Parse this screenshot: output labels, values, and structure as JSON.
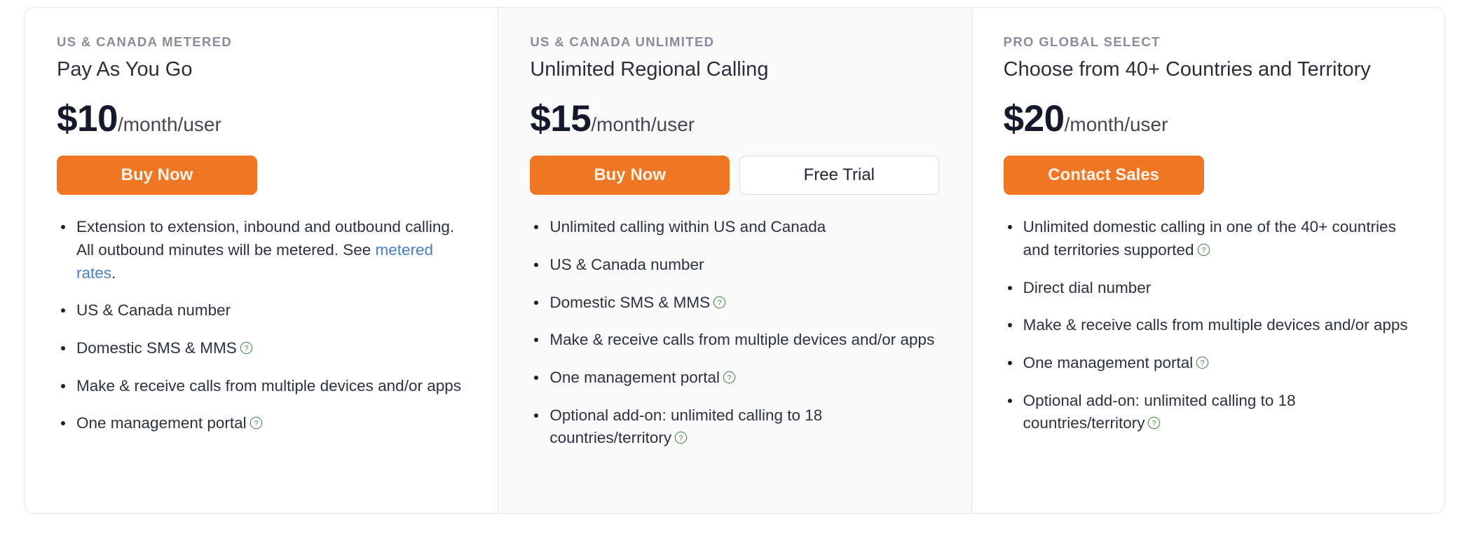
{
  "colors": {
    "primary_button": "#ef7622",
    "link": "#4a7fc6",
    "help_icon": "#4f8a55",
    "eyebrow_text": "#8b8b9b",
    "card_border": "#e8e8ea",
    "tinted_column_bg": "#fafafb"
  },
  "plans": [
    {
      "eyebrow": "US & Canada Metered",
      "title": "Pay As You Go",
      "price": "$10",
      "period": "/month/user",
      "highlighted": false,
      "buttons": [
        {
          "label": "Buy Now",
          "style": "primary",
          "name": "buy-now-button"
        }
      ],
      "features": [
        {
          "text_before": "Extension to extension, inbound and outbound calling. All outbound minutes will be metered. See ",
          "link": "metered rates",
          "text_after": ".",
          "help": false
        },
        {
          "text_before": "US & Canada number",
          "link": "",
          "text_after": "",
          "help": false
        },
        {
          "text_before": "Domestic SMS & MMS",
          "link": "",
          "text_after": "",
          "help": true
        },
        {
          "text_before": "Make & receive calls from multiple devices and/or apps",
          "link": "",
          "text_after": "",
          "help": false
        },
        {
          "text_before": "One management portal",
          "link": "",
          "text_after": "",
          "help": true
        }
      ]
    },
    {
      "eyebrow": "US & Canada Unlimited",
      "title": "Unlimited Regional Calling",
      "price": "$15",
      "period": "/month/user",
      "highlighted": true,
      "buttons": [
        {
          "label": "Buy Now",
          "style": "primary",
          "name": "buy-now-button"
        },
        {
          "label": "Free Trial",
          "style": "secondary",
          "name": "free-trial-button"
        }
      ],
      "features": [
        {
          "text_before": "Unlimited calling within US and Canada",
          "link": "",
          "text_after": "",
          "help": false
        },
        {
          "text_before": "US & Canada number",
          "link": "",
          "text_after": "",
          "help": false
        },
        {
          "text_before": "Domestic SMS & MMS",
          "link": "",
          "text_after": "",
          "help": true
        },
        {
          "text_before": "Make & receive calls from multiple devices and/or apps",
          "link": "",
          "text_after": "",
          "help": false
        },
        {
          "text_before": "One management portal",
          "link": "",
          "text_after": "",
          "help": true
        },
        {
          "text_before": "Optional add-on: unlimited calling to 18 countries/territory",
          "link": "",
          "text_after": "",
          "help": true
        }
      ]
    },
    {
      "eyebrow": "Pro Global Select",
      "title": "Choose from 40+ Countries and Territory",
      "price": "$20",
      "period": "/month/user",
      "highlighted": false,
      "buttons": [
        {
          "label": "Contact Sales",
          "style": "primary",
          "name": "contact-sales-button"
        }
      ],
      "features": [
        {
          "text_before": "Unlimited domestic calling in one of the 40+ countries and territories supported",
          "link": "",
          "text_after": "",
          "help": true
        },
        {
          "text_before": "Direct dial number",
          "link": "",
          "text_after": "",
          "help": false
        },
        {
          "text_before": "Make & receive calls from multiple devices and/or apps",
          "link": "",
          "text_after": "",
          "help": false
        },
        {
          "text_before": "One management portal",
          "link": "",
          "text_after": "",
          "help": true
        },
        {
          "text_before": "Optional add-on: unlimited calling to 18 countries/territory",
          "link": "",
          "text_after": "",
          "help": true
        }
      ]
    }
  ]
}
